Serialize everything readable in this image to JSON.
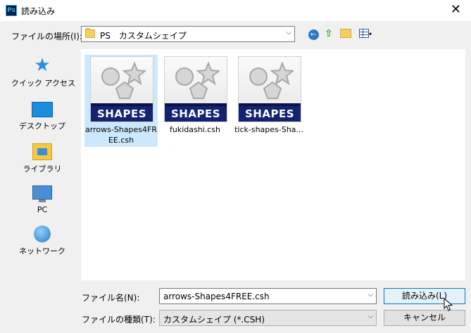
{
  "window": {
    "title": "読み込み",
    "app_icon": "Ps",
    "close_glyph": "✕"
  },
  "location": {
    "label": "ファイルの場所(I):",
    "value": "PS　カスタムシェイプ"
  },
  "toolbar": {
    "back_glyph": "←",
    "up_glyph": "⇧",
    "view_arrow": "▾"
  },
  "sidebar": {
    "items": [
      {
        "label": "クイック アクセス",
        "icon": "star-icon"
      },
      {
        "label": "デスクトップ",
        "icon": "desktop-icon"
      },
      {
        "label": "ライブラリ",
        "icon": "library-icon"
      },
      {
        "label": "PC",
        "icon": "pc-icon"
      },
      {
        "label": "ネットワーク",
        "icon": "network-icon"
      }
    ]
  },
  "files": [
    {
      "name": "arrows-Shapes4FREE.csh",
      "badge": "SHAPES",
      "selected": true
    },
    {
      "name": "fukidashi.csh",
      "badge": "SHAPES",
      "selected": false
    },
    {
      "name": "tick-shapes-Sha...",
      "badge": "SHAPES",
      "selected": false
    }
  ],
  "filename": {
    "label": "ファイル名(N):",
    "value": "arrows-Shapes4FREE.csh"
  },
  "filetype": {
    "label": "ファイルの種類(T):",
    "value": "カスタムシェイプ (*.CSH)"
  },
  "buttons": {
    "open": "読み込み(L)",
    "cancel": "キャンセル"
  },
  "colors": {
    "selection": "#cce8ff",
    "badge": "#142272",
    "accent": "#0078d7"
  }
}
